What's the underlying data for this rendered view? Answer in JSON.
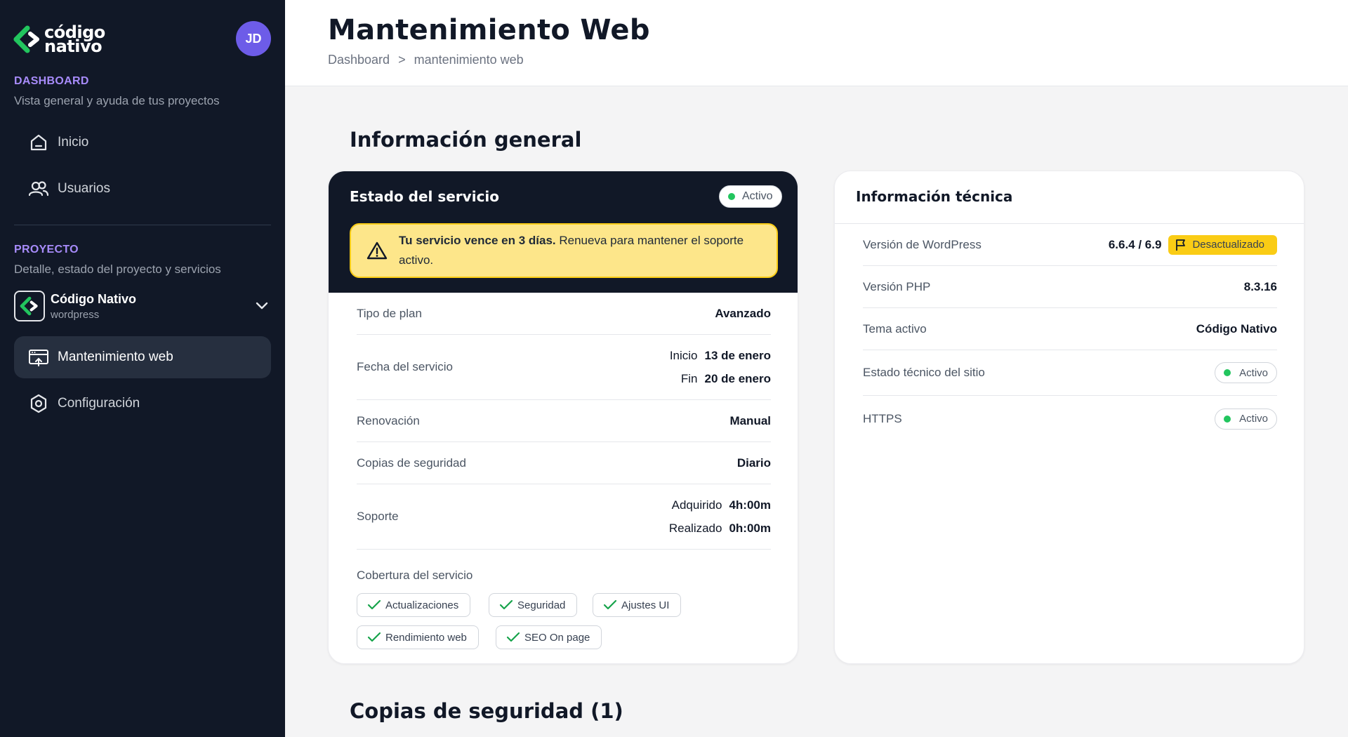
{
  "brand": {
    "logo_line1": "código",
    "logo_line2": "nativo",
    "avatar_initials": "JD"
  },
  "sidebar": {
    "dashboard": {
      "title": "DASHBOARD",
      "subtitle": "Vista general y ayuda de tus proyectos"
    },
    "dashboard_items": [
      {
        "label": "Inicio",
        "icon": "home-icon"
      },
      {
        "label": "Usuarios",
        "icon": "users-icon"
      }
    ],
    "project_section": {
      "title": "PROYECTO",
      "subtitle": "Detalle, estado del proyecto y servicios"
    },
    "project": {
      "name": "Código Nativo",
      "type": "wordpress"
    },
    "project_items": [
      {
        "label": "Mantenimiento web",
        "icon": "browser-icon",
        "active": true
      },
      {
        "label": "Configuración",
        "icon": "settings-icon"
      }
    ]
  },
  "header": {
    "title": "Mantenimiento Web",
    "breadcrumb": {
      "root": "Dashboard",
      "separator": ">",
      "current": "mantenimiento web"
    }
  },
  "sections": {
    "general": "Información general",
    "backups": "Copias de seguridad (1)"
  },
  "service_card": {
    "title": "Estado del servicio",
    "status": "Activo",
    "alert": {
      "bold": "Tu servicio vence en 3 días.",
      "text": "Renueva para mantener el soporte activo."
    },
    "rows": {
      "plan": {
        "label": "Tipo de plan",
        "value": "Avanzado"
      },
      "date": {
        "label": "Fecha del servicio",
        "start_label": "Inicio",
        "start_value": "13 de enero",
        "end_label": "Fin",
        "end_value": "20 de enero"
      },
      "renewal": {
        "label": "Renovación",
        "value": "Manual"
      },
      "backups": {
        "label": "Copias de seguridad",
        "value": "Diario"
      },
      "support": {
        "label": "Soporte",
        "acq_label": "Adquirido",
        "acq_value": "4h:00m",
        "done_label": "Realizado",
        "done_value": "0h:00m"
      }
    },
    "coverage": {
      "title": "Cobertura del servicio",
      "chips": [
        "Actualizaciones",
        "Seguridad",
        "Ajustes UI",
        "Rendimiento web",
        "SEO On page"
      ]
    }
  },
  "tech_card": {
    "title": "Información técnica",
    "wordpress": {
      "label": "Versión de WordPress",
      "value": "6.6.4 / 6.9",
      "badge": "Desactualizado"
    },
    "php": {
      "label": "Versión PHP",
      "value": "8.3.16"
    },
    "theme": {
      "label": "Tema activo",
      "value": "Código Nativo"
    },
    "site_status": {
      "label": "Estado técnico del sitio",
      "value": "Activo"
    },
    "https": {
      "label": "HTTPS",
      "value": "Activo"
    }
  },
  "colors": {
    "sidebar_bg": "#111827",
    "accent": "#a78bfa",
    "brand_green": "#22c55e",
    "warning": "#facc15"
  }
}
